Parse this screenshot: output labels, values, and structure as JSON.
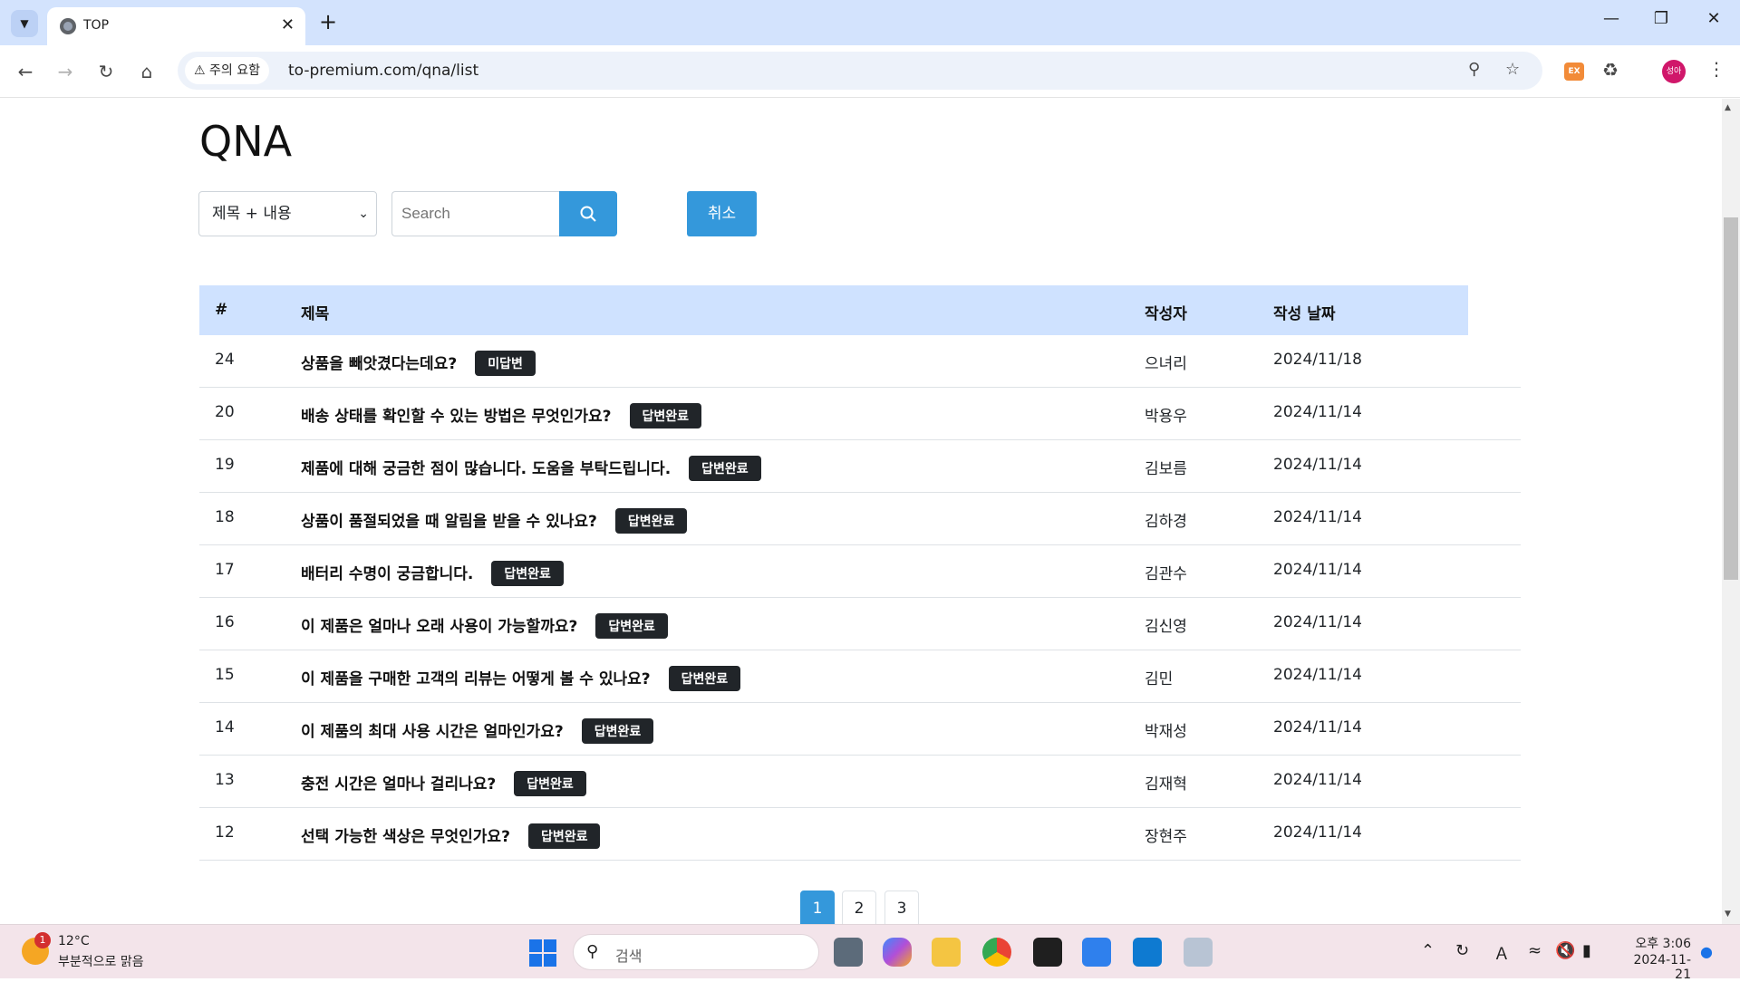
{
  "browser": {
    "tab_title": "TOP",
    "tab_close": "✕",
    "new_tab": "+",
    "security_label": "주의 요함",
    "url": "to-premium.com/qna/list",
    "profile_initials": "성아",
    "ext_label": "EX"
  },
  "page": {
    "title": "QNA",
    "search_scope": "제목 + 내용",
    "search_placeholder": "Search",
    "cancel_label": "취소",
    "columns": {
      "num": "#",
      "title": "제목",
      "writer": "작성자",
      "date": "작성 날짜"
    },
    "rows": [
      {
        "num": "24",
        "title": "상품을 빼앗겼다는데요?",
        "status": "미답변",
        "writer": "으녀리",
        "date": "2024/11/18"
      },
      {
        "num": "20",
        "title": "배송 상태를 확인할 수 있는 방법은 무엇인가요?",
        "status": "답변완료",
        "writer": "박용우",
        "date": "2024/11/14"
      },
      {
        "num": "19",
        "title": "제품에 대해 궁금한 점이 많습니다. 도움을 부탁드립니다.",
        "status": "답변완료",
        "writer": "김보름",
        "date": "2024/11/14"
      },
      {
        "num": "18",
        "title": "상품이 품절되었을 때 알림을 받을 수 있나요?",
        "status": "답변완료",
        "writer": "김하경",
        "date": "2024/11/14"
      },
      {
        "num": "17",
        "title": "배터리 수명이 궁금합니다.",
        "status": "답변완료",
        "writer": "김관수",
        "date": "2024/11/14"
      },
      {
        "num": "16",
        "title": "이 제품은 얼마나 오래 사용이 가능할까요?",
        "status": "답변완료",
        "writer": "김신영",
        "date": "2024/11/14"
      },
      {
        "num": "15",
        "title": "이 제품을 구매한 고객의 리뷰는 어떻게 볼 수 있나요?",
        "status": "답변완료",
        "writer": "김민",
        "date": "2024/11/14"
      },
      {
        "num": "14",
        "title": "이 제품의 최대 사용 시간은 얼마인가요?",
        "status": "답변완료",
        "writer": "박재성",
        "date": "2024/11/14"
      },
      {
        "num": "13",
        "title": "충전 시간은 얼마나 걸리나요?",
        "status": "답변완료",
        "writer": "김재혁",
        "date": "2024/11/14"
      },
      {
        "num": "12",
        "title": "선택 가능한 색상은 무엇인가요?",
        "status": "답변완료",
        "writer": "장현주",
        "date": "2024/11/14"
      }
    ],
    "pages": [
      "1",
      "2",
      "3"
    ],
    "current_page": "1"
  },
  "taskbar": {
    "weather_temp": "12°C",
    "weather_desc": "부분적으로 맑음",
    "weather_badge": "1",
    "search_label": "검색",
    "time": "오후 3:06",
    "date": "2024-11-21"
  },
  "colors": {
    "accent": "#3498db",
    "header_bg": "#cfe2ff",
    "badge_bg": "#212529",
    "tabbar_bg": "#d3e3fd",
    "taskbar_bg": "#f3e4ea"
  }
}
